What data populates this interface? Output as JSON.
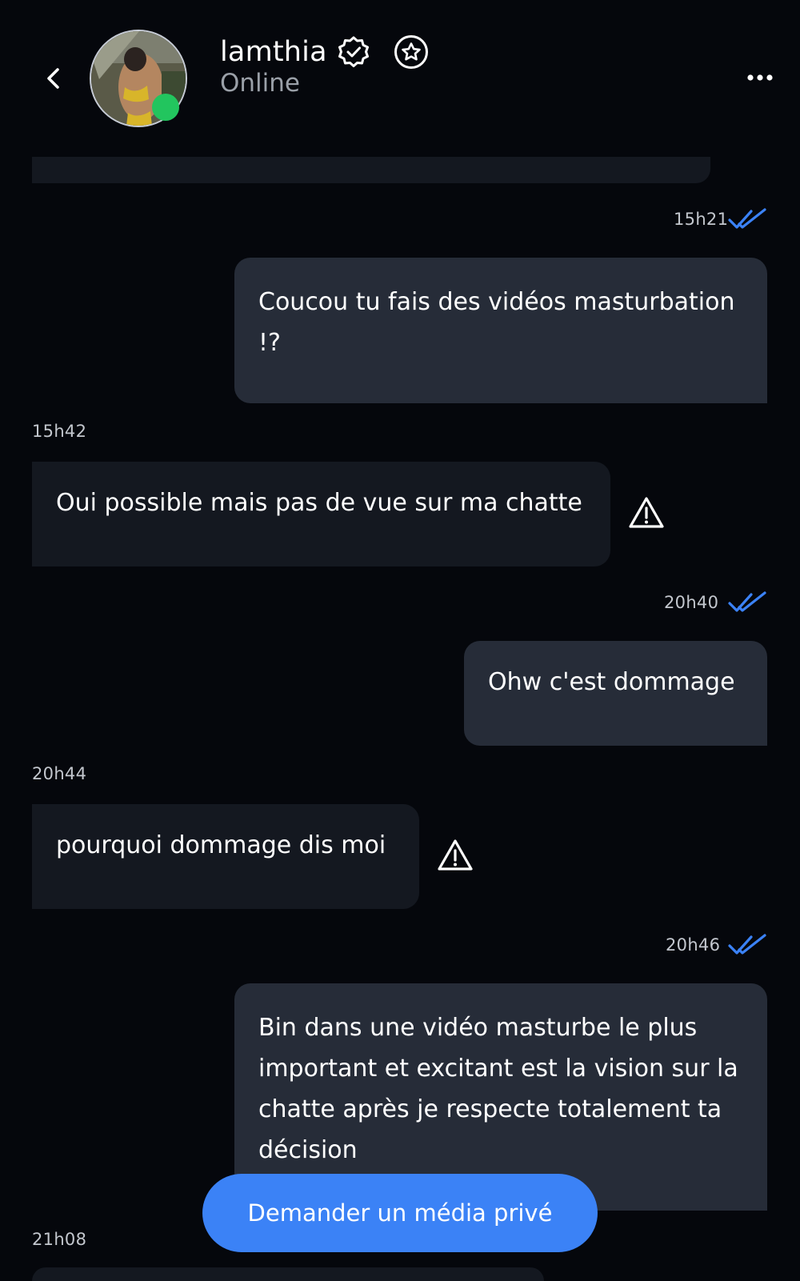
{
  "header": {
    "username": "lamthia",
    "status": "Online",
    "icons": {
      "back": "chevron-left-icon",
      "verified": "verified-badge-icon",
      "favorite": "star-circle-icon",
      "more": "more-horizontal-icon"
    },
    "colors": {
      "online": "#22c55e"
    }
  },
  "messages": [
    {
      "direction": "out",
      "time": "15h21",
      "read": true,
      "text": "Coucou tu fais des vidéos masturbation !?"
    },
    {
      "direction": "in",
      "time": "15h42",
      "flagged": true,
      "text": "Oui possible mais pas de vue sur ma chatte"
    },
    {
      "direction": "out",
      "time": "20h40",
      "read": true,
      "text": "Ohw c'est dommage"
    },
    {
      "direction": "in",
      "time": "20h44",
      "flagged": true,
      "text": "pourquoi dommage dis moi"
    },
    {
      "direction": "out",
      "time": "20h46",
      "read": true,
      "text": "Bin dans une vidéo masturbe le plus important et excitant est la vision sur la chatte après je respecte totalement ta décision"
    },
    {
      "direction": "in",
      "time": "21h08",
      "text": ""
    }
  ],
  "actions": {
    "request_media_label": "Demander un média privé"
  },
  "colors": {
    "background": "#05070c",
    "outgoing_bubble": "#262c38",
    "incoming_bubble": "#141820",
    "accent": "#3b82f6",
    "read_check": "#3b82f6"
  }
}
